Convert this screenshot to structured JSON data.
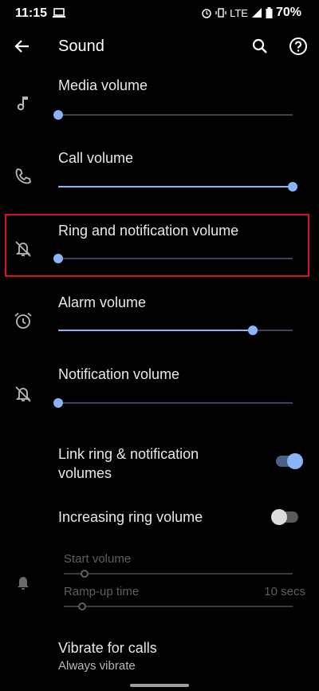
{
  "status_bar": {
    "time": "11:15",
    "network": "LTE",
    "battery": "70%"
  },
  "header": {
    "title": "Sound"
  },
  "volumes": [
    {
      "label": "Media volume",
      "level": 0.0,
      "icon": "music-note-icon"
    },
    {
      "label": "Call volume",
      "level": 1.0,
      "icon": "phone-icon"
    },
    {
      "label": "Ring and notification volume",
      "level": 0.0,
      "icon": "bell-off-icon"
    },
    {
      "label": "Alarm volume",
      "level": 0.83,
      "icon": "alarm-icon"
    },
    {
      "label": "Notification volume",
      "level": 0.0,
      "icon": "bell-off-icon"
    }
  ],
  "link_ring": {
    "label_line1": "Link ring & notification",
    "label_line2": "volumes",
    "enabled": true
  },
  "increasing_ring": {
    "label": "Increasing ring volume",
    "enabled": false,
    "start_volume_label": "Start volume",
    "start_volume_level": 0.09,
    "ramp_label": "Ramp-up time",
    "ramp_value": "10 secs",
    "ramp_level": 0.08
  },
  "vibrate": {
    "label": "Vibrate for calls",
    "value": "Always vibrate"
  },
  "colors": {
    "accent": "#8ab4f8",
    "highlight_border": "#e01020",
    "background": "#000000"
  }
}
